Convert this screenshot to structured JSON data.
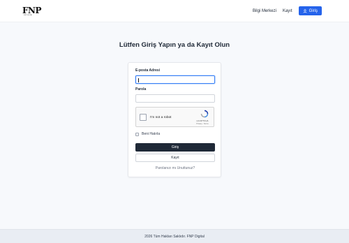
{
  "header": {
    "logo": "FNP",
    "logo_tagline": "FNP DIGITAL",
    "nav": {
      "info_center": "Bilgi Merkezi",
      "register": "Kayıt",
      "login": "Giriş"
    }
  },
  "main": {
    "title": "Lütfen Giriş Yapın ya da Kayıt Olun"
  },
  "form": {
    "email_label": "E-posta Adresi",
    "email_value": "",
    "password_label": "Parola",
    "password_value": "",
    "captcha": {
      "text": "I'm not a robot",
      "brand": "reCAPTCHA",
      "links": "Privacy - Terms"
    },
    "remember_label": "Beni Hatırla",
    "remember_checked": false,
    "login_button": "Giriş",
    "register_button": "Kayıt",
    "forgot_link": "Parolanızı mı Unuttunuz?"
  },
  "footer": {
    "text": "2026 Tüm Hakları Saklıdır. FNP Digital"
  },
  "colors": {
    "primary": "#2563eb",
    "dark_button": "#1f2937",
    "page_bg": "#f7f9fc"
  },
  "icons": {
    "login": "user-icon",
    "captcha": "recaptcha-logo-icon"
  }
}
